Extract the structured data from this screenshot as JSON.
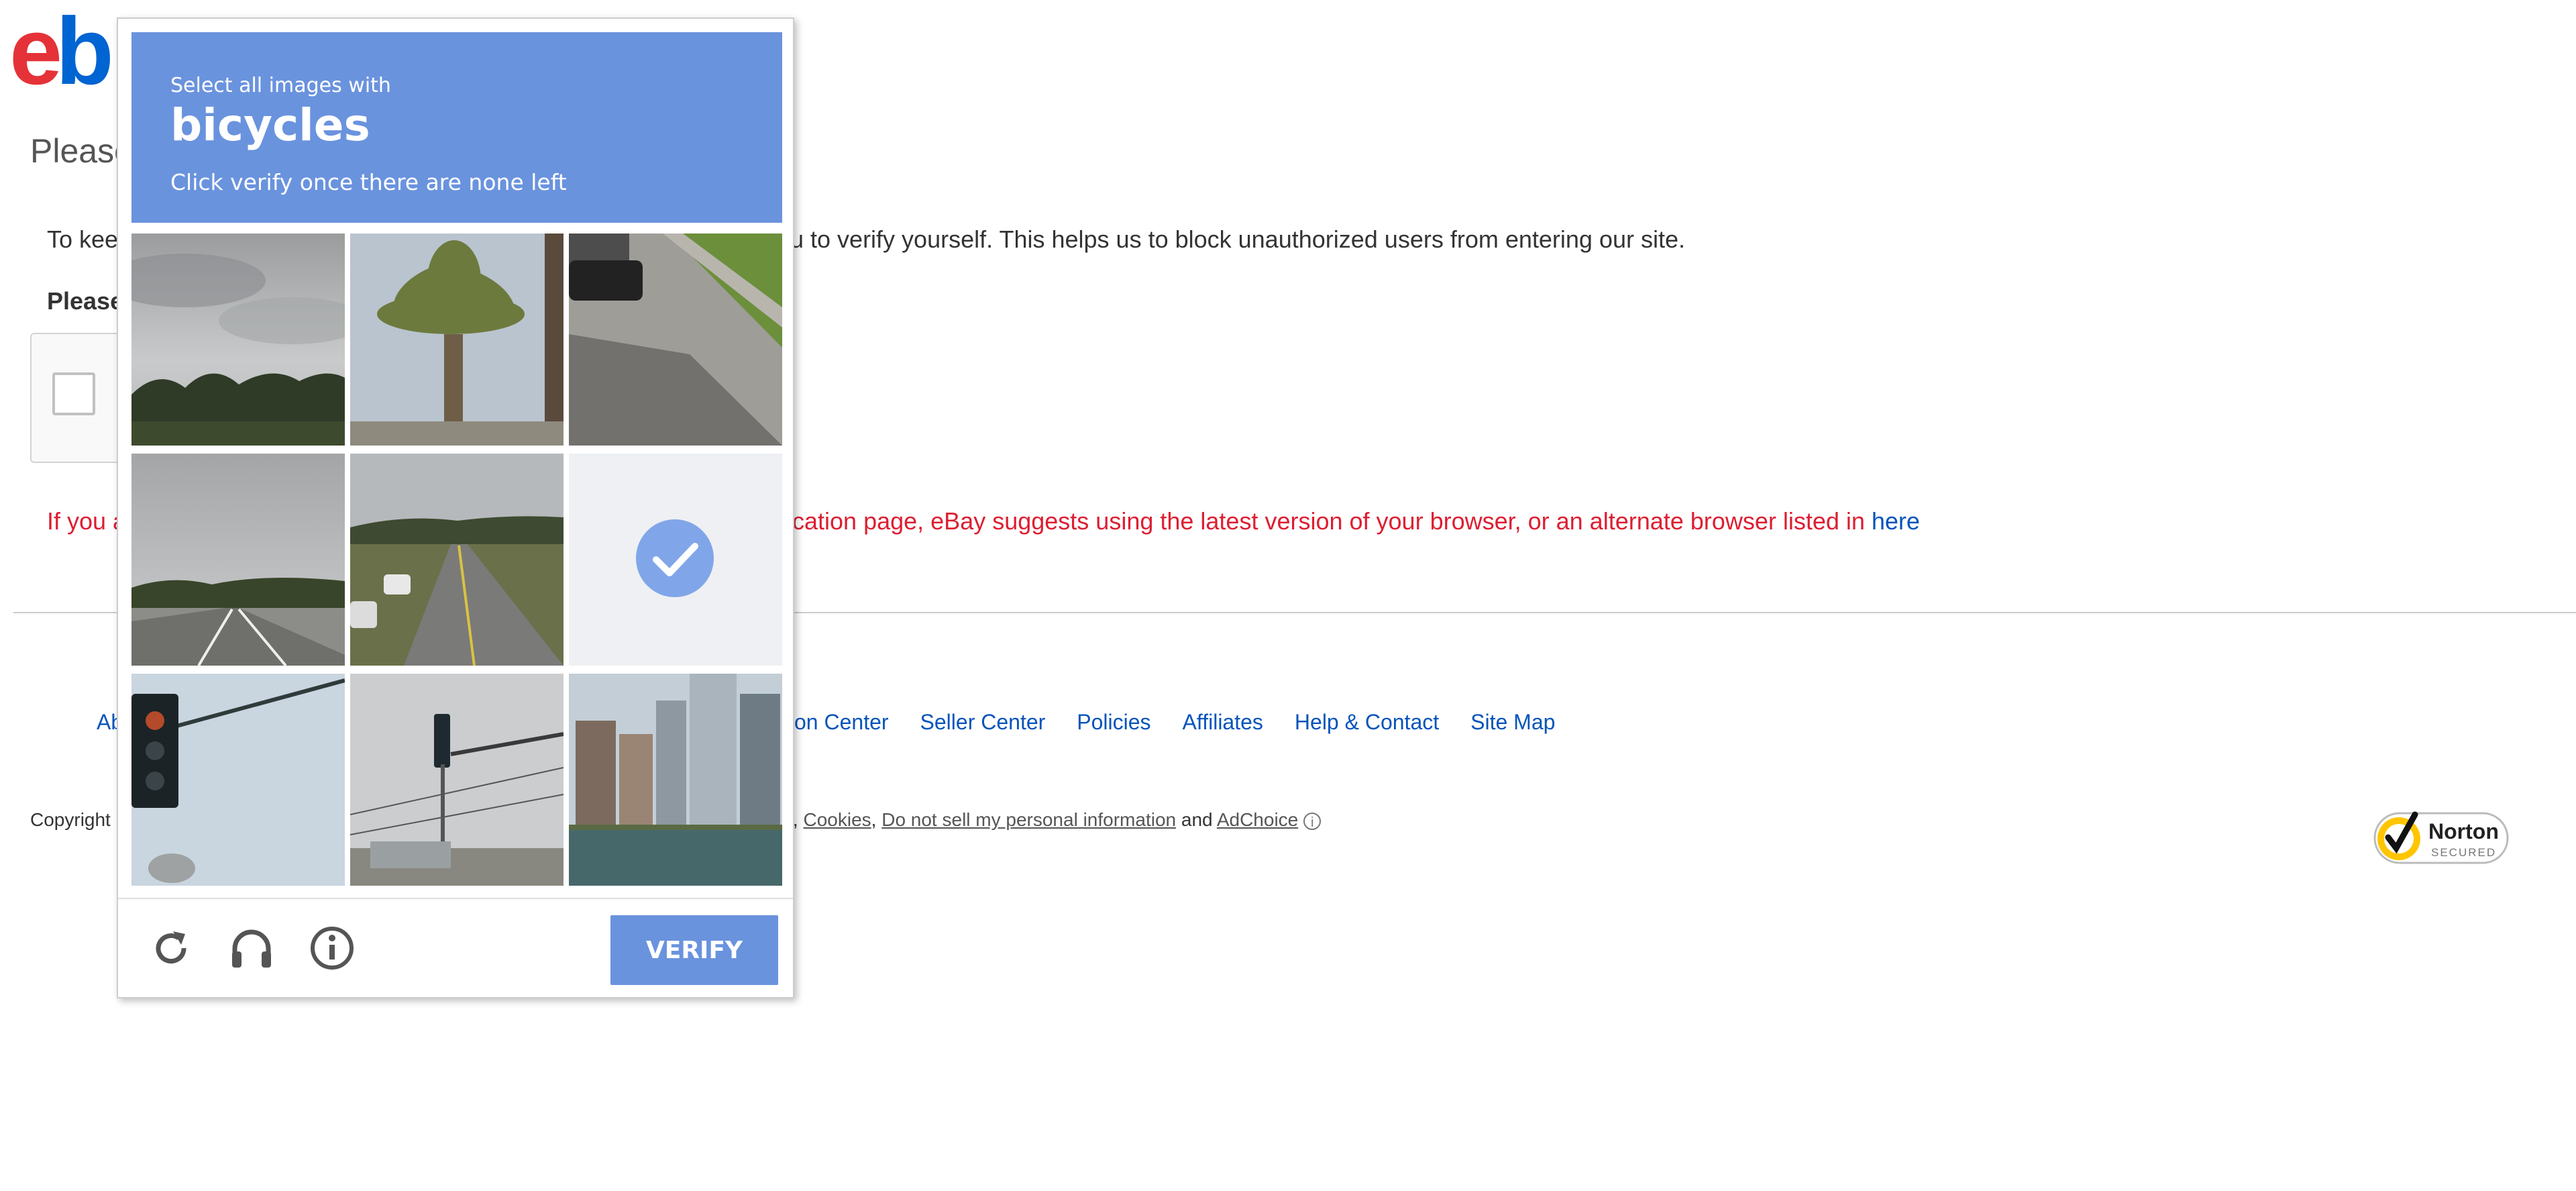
{
  "page": {
    "logo": {
      "e": "e",
      "b": "b"
    },
    "title": "Please",
    "intro_left": "To kee",
    "intro_right": "u to verify yourself. This helps us to block unauthorized users from entering our site.",
    "please_label": "Please",
    "warning_left": "If you a",
    "warning_right": "ification page, eBay suggests using the latest version of your browser, or an alternate browser listed in ",
    "warning_link": "here"
  },
  "footer": {
    "left_fragment": "Ab",
    "links": [
      "tion Center",
      "Seller Center",
      "Policies",
      "Affiliates",
      "Help & Contact",
      "Site Map"
    ],
    "copyright_left": "Copyright ",
    "legal": {
      "fragment": "y",
      "cookies": "Cookies",
      "do_not_sell": "Do not sell my personal information",
      "and": "and",
      "adchoice": "AdChoice"
    },
    "norton": {
      "name": "Norton",
      "sub": "SECURED"
    }
  },
  "captcha": {
    "instruction_top": "Select all images with",
    "target": "bicycles",
    "instruction_bottom": "Click verify once there are none left",
    "tiles": [
      {
        "scene": "cloudy sky over trees",
        "selected": false
      },
      {
        "scene": "palm tree",
        "selected": false
      },
      {
        "scene": "parked car and road",
        "selected": false
      },
      {
        "scene": "highway under cloudy sky",
        "selected": false
      },
      {
        "scene": "road with cars",
        "selected": false
      },
      {
        "scene": "tile being reloaded",
        "selected": true
      },
      {
        "scene": "traffic light close-up",
        "selected": false
      },
      {
        "scene": "traffic light on pole",
        "selected": false
      },
      {
        "scene": "city skyline over river",
        "selected": false
      }
    ],
    "verify_label": "VERIFY",
    "icons": [
      "reload-icon",
      "headphones-icon",
      "info-icon"
    ]
  },
  "colors": {
    "accent": "#6a93de",
    "ebay_red": "#e53238",
    "ebay_blue": "#0064d2",
    "link": "#0654ba",
    "warning": "#dd1e31"
  }
}
